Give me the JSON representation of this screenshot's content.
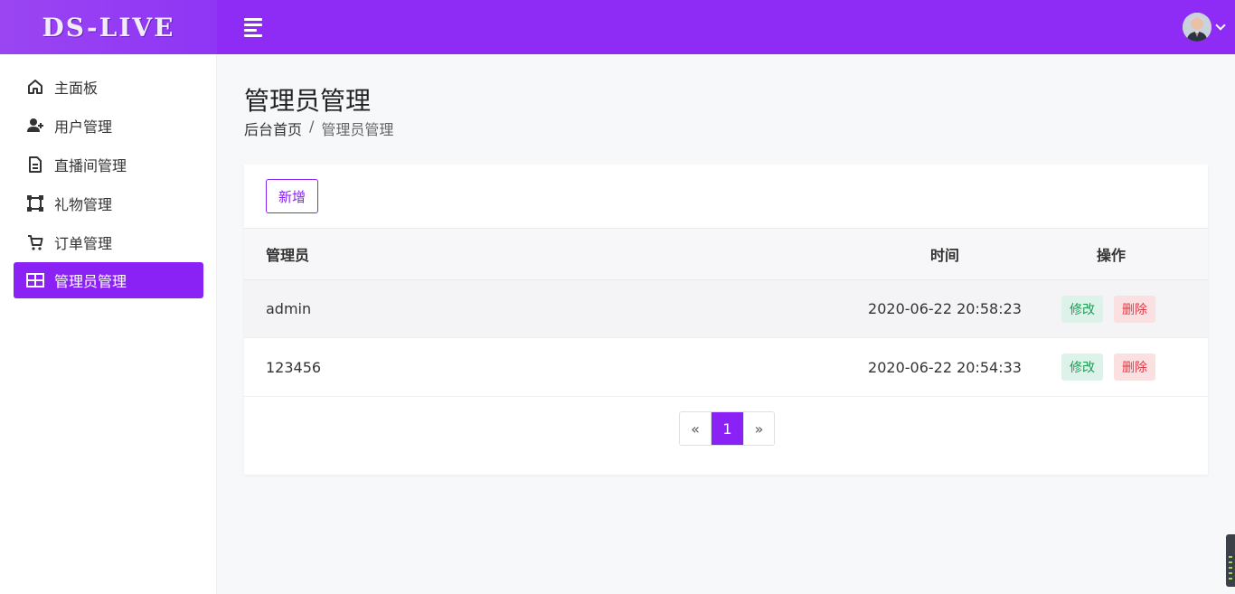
{
  "app": {
    "brand": "DS-LIVE"
  },
  "sidebar": {
    "items": [
      {
        "label": "主面板",
        "icon": "home-icon"
      },
      {
        "label": "用户管理",
        "icon": "user-plus-icon"
      },
      {
        "label": "直播间管理",
        "icon": "document-icon"
      },
      {
        "label": "礼物管理",
        "icon": "vector-square-icon"
      },
      {
        "label": "订单管理",
        "icon": "cart-icon"
      },
      {
        "label": "管理员管理",
        "icon": "table-icon",
        "active": true
      }
    ]
  },
  "page": {
    "title": "管理员管理",
    "breadcrumb": {
      "home": "后台首页",
      "separator": "/",
      "current": "管理员管理"
    }
  },
  "toolbar": {
    "add_label": "新增"
  },
  "table": {
    "columns": [
      "管理员",
      "时间",
      "操作"
    ],
    "rows": [
      {
        "name": "admin",
        "time": "2020-06-22 20:58:23",
        "edit": "修改",
        "delete": "删除"
      },
      {
        "name": "123456",
        "time": "2020-06-22 20:54:33",
        "edit": "修改",
        "delete": "删除"
      }
    ]
  },
  "pagination": {
    "prev": "«",
    "current": "1",
    "next": "»"
  },
  "colors": {
    "accent": "#8a22f5",
    "edit_bg": "#ddf3ea",
    "delete_bg": "#fbe0e2"
  }
}
